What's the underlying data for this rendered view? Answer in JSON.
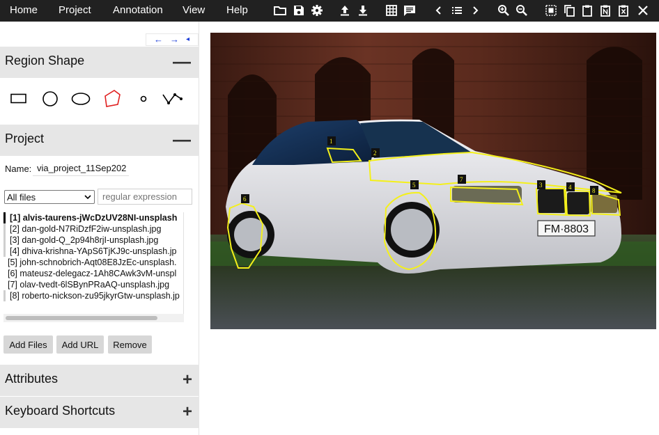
{
  "menu": {
    "home": "Home",
    "project": "Project",
    "annotation": "Annotation",
    "view": "View",
    "help": "Help"
  },
  "toolbar_icons": [
    "open-folder-icon",
    "save-icon",
    "settings-icon",
    "upload-icon",
    "download-icon",
    "grid-icon",
    "comment-icon",
    "chevron-left-icon",
    "list-icon",
    "chevron-right-icon",
    "zoom-in-icon",
    "zoom-out-icon",
    "select-all-icon",
    "copy-icon",
    "paste-icon",
    "paste-n-icon",
    "delete-icon",
    "close-icon"
  ],
  "panel_arrows": {
    "left": "←",
    "right": "→",
    "collapse": "◂"
  },
  "region_shape": {
    "title": "Region Shape",
    "toggle": "—",
    "shapes": [
      "rectangle-icon",
      "circle-icon",
      "ellipse-icon",
      "polygon-icon",
      "point-icon",
      "polyline-icon"
    ],
    "selected": "polygon-icon",
    "selected_color": "#e02020"
  },
  "project": {
    "title": "Project",
    "toggle": "—",
    "name_label": "Name:",
    "name_value": "via_project_11Sep202",
    "filter_value": "All files",
    "regex_placeholder": "regular expression",
    "files": [
      "[1] alvis-taurens-jWcDzUV28NI-unsplash",
      "[2] dan-gold-N7RiDzfF2iw-unsplash.jpg",
      "[3] dan-gold-Q_2p94h8rjI-unsplash.jpg",
      "[4] dhiva-krishna-YApS6TjKJ9c-unsplash.jp",
      "[5] john-schnobrich-Aqt08E8JzEc-unsplash.",
      "[6] mateusz-delegacz-1Ah8CAwk3vM-unspl",
      "[7] olav-tvedt-6lSBynPRaAQ-unsplash.jpg",
      "[8] roberto-nickson-zu95jkyrGtw-unsplash.jp"
    ],
    "buttons": {
      "add_files": "Add Files",
      "add_url": "Add URL",
      "remove": "Remove"
    }
  },
  "attributes": {
    "title": "Attributes",
    "toggle": "+"
  },
  "shortcuts": {
    "title": "Keyboard Shortcuts",
    "toggle": "+"
  },
  "canvas": {
    "plate_text": "FM·8803",
    "regions": [
      {
        "id": "1"
      },
      {
        "id": "2"
      },
      {
        "id": "3"
      },
      {
        "id": "4"
      },
      {
        "id": "5"
      },
      {
        "id": "6"
      },
      {
        "id": "7"
      },
      {
        "id": "8"
      }
    ],
    "region_color": "#f4f01a"
  }
}
